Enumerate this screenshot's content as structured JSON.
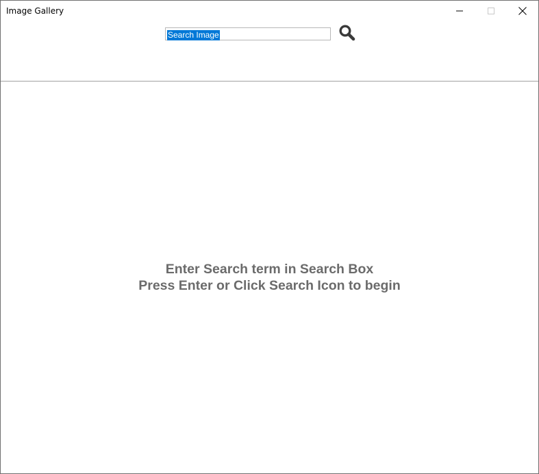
{
  "window": {
    "title": "Image Gallery",
    "controls": [
      "minimize-icon",
      "maximize-icon",
      "close-icon"
    ]
  },
  "search": {
    "value": "Search Image",
    "icon": "search-icon"
  },
  "message": {
    "line1": "Enter Search term in Search Box",
    "line2": "Press Enter or Click Search Icon to begin"
  },
  "colors": {
    "selection": "#0078d7",
    "message_text": "#6b6b6b",
    "icon": "#3a3a3a"
  }
}
